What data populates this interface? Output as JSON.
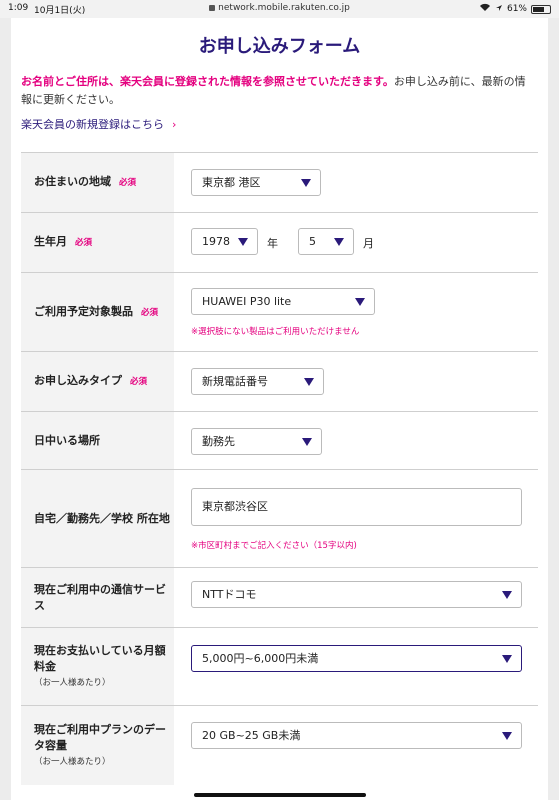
{
  "statusbar": {
    "time": "1:09",
    "date": "10月1日(火)",
    "url": "network.mobile.rakuten.co.jp",
    "battery": "61%",
    "battery_level": 0.61
  },
  "header": {
    "title": "お申し込みフォーム"
  },
  "notice": {
    "emphasis": "お名前とご住所は、楽天会員に登録された情報を参照させていただきます。",
    "rest": "お申し込み前に、最新の情報に更新ください。"
  },
  "signup_link": {
    "label": "楽天会員の新規登録はこちら",
    "chevron": "›"
  },
  "required_label": "必須",
  "form": {
    "region": {
      "label": "お住まいの地域",
      "value": "東京都 港区"
    },
    "birth": {
      "label": "生年月",
      "year": "1978",
      "year_unit": "年",
      "month": "5",
      "month_unit": "月"
    },
    "product": {
      "label": "ご利用予定対象製品",
      "value": "HUAWEI P30 lite",
      "hint": "※選択肢にない製品はご利用いただけません"
    },
    "apply_type": {
      "label": "お申し込みタイプ",
      "value": "新規電話番号"
    },
    "daytime": {
      "label": "日中いる場所",
      "value": "勤務先"
    },
    "location": {
      "label": "自宅／勤務先／学校 所在地",
      "value": "東京都渋谷区",
      "hint": "※市区町村までご記入ください（15字以内)"
    },
    "carrier": {
      "label": "現在ご利用中の通信サービス",
      "value": "NTTドコモ"
    },
    "monthly": {
      "label": "現在お支払いしている月額料金",
      "sub": "（お一人様あたり）",
      "value": "5,000円~6,000円未満"
    },
    "data": {
      "label": "現在ご利用中プランのデータ容量",
      "sub": "（お一人様あたり）",
      "value": "20 GB~25 GB未満"
    }
  },
  "colors": {
    "accent": "#e4007f",
    "brand": "#2a1a7a"
  }
}
